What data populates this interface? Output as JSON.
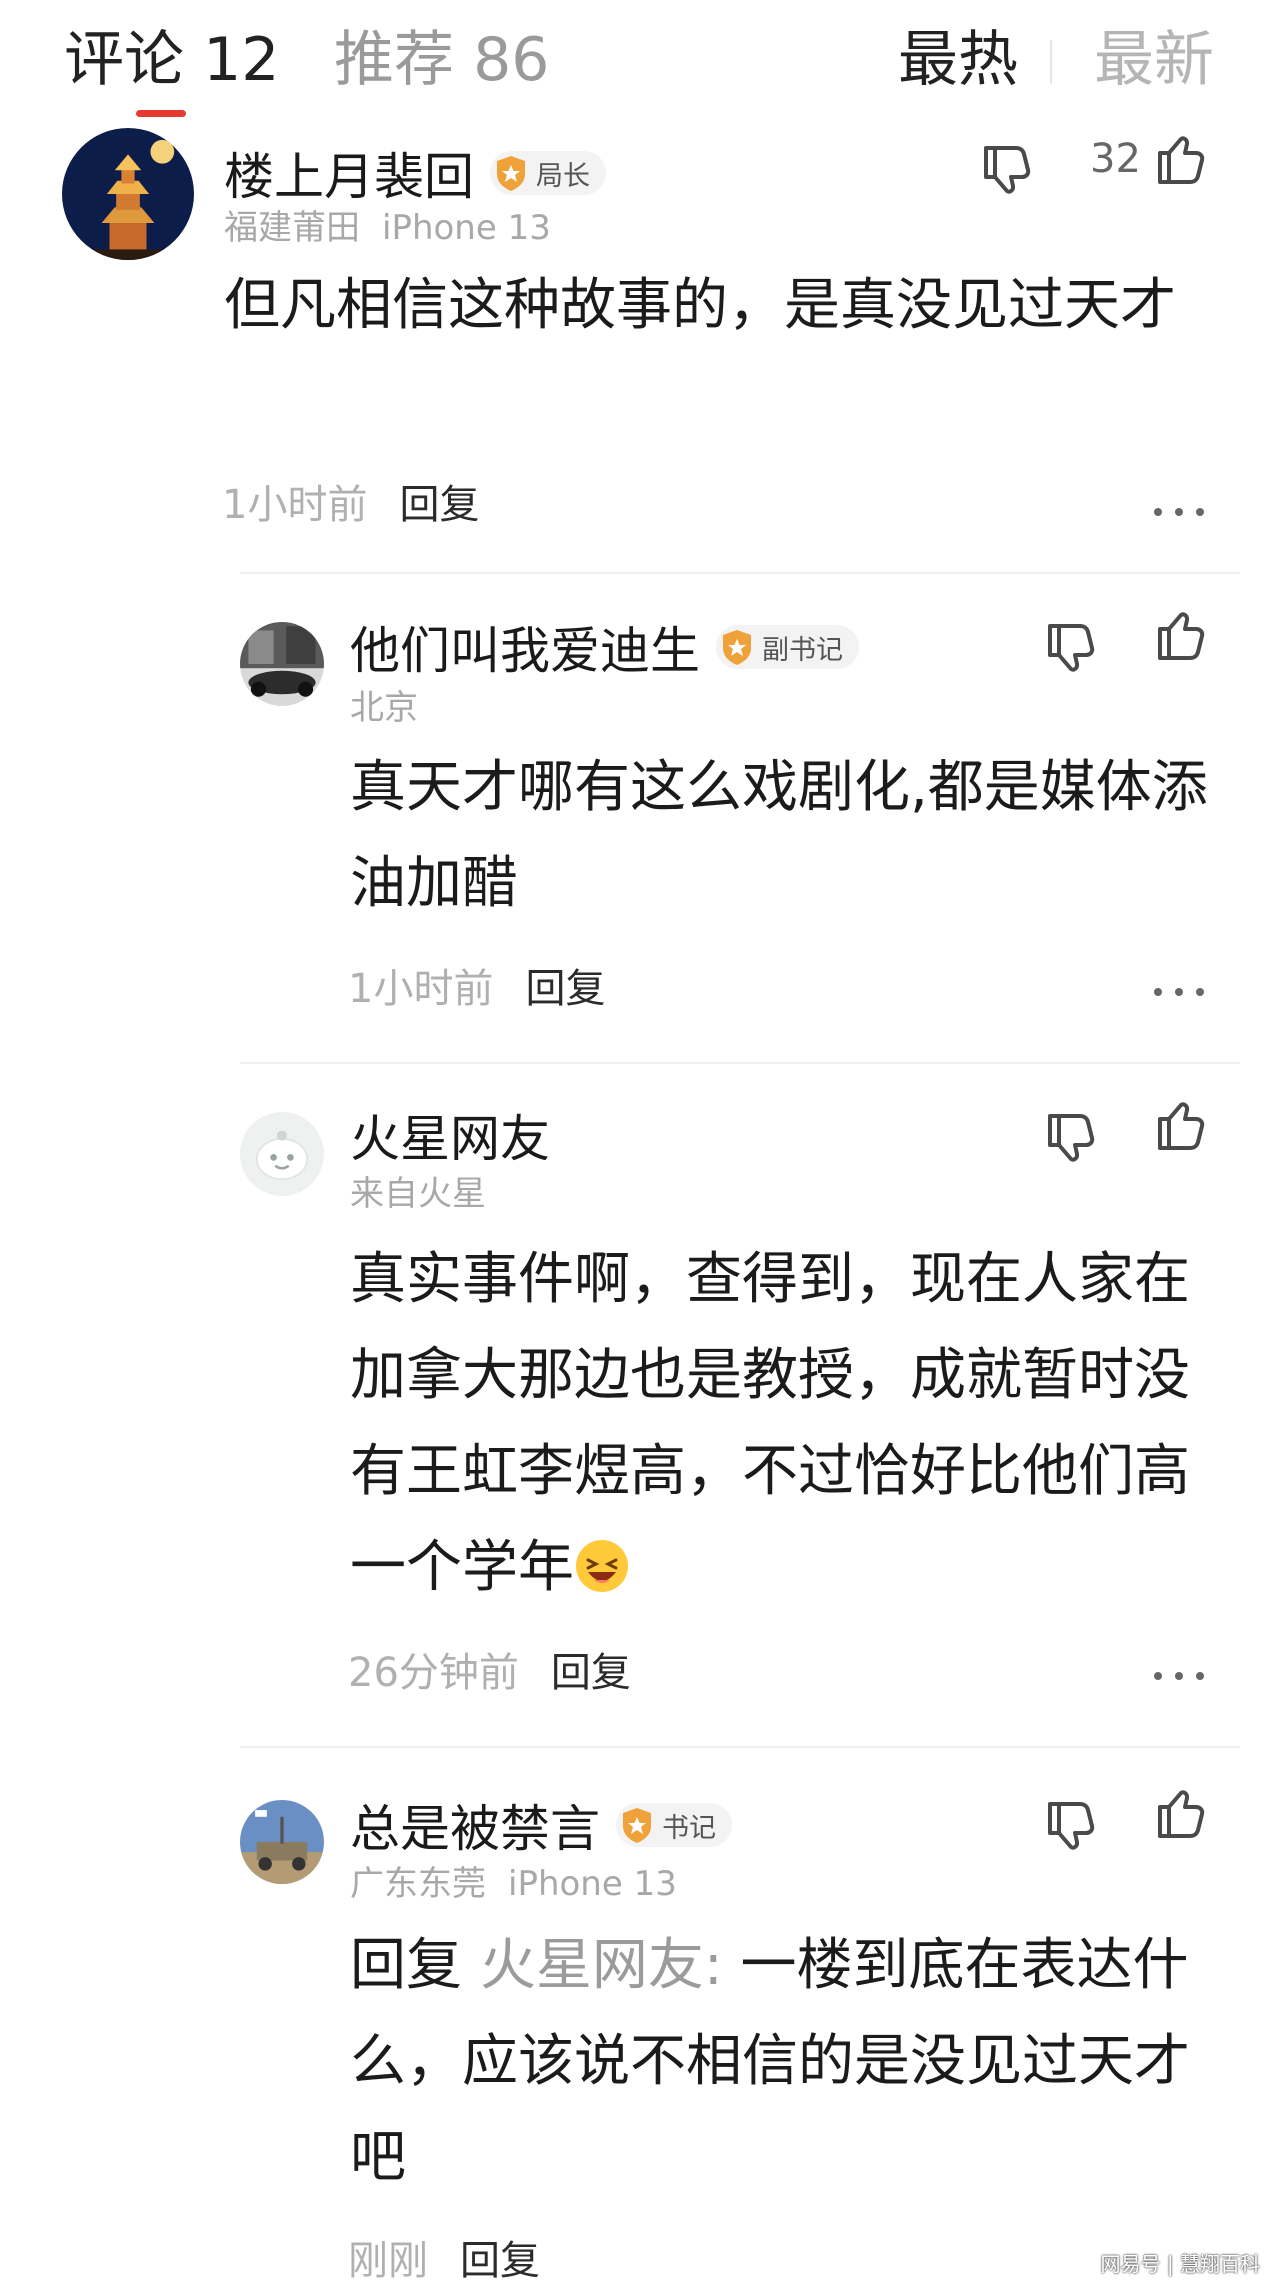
{
  "tabs": {
    "comments": "评论 12",
    "recommend": "推荐 86",
    "hot": "最热",
    "latest": "最新"
  },
  "comments": [
    {
      "name": "楼上月裴回",
      "badge": "局长",
      "location": "福建莆田",
      "device": "iPhone 13",
      "text": "但凡相信这种故事的，是真没见过天才",
      "time": "1小时前",
      "reply_label": "回复",
      "likes": "32"
    },
    {
      "name": "他们叫我爱迪生",
      "badge": "副书记",
      "location": "北京",
      "text": "真天才哪有这么戏剧化,都是媒体添油加醋",
      "time": "1小时前",
      "reply_label": "回复"
    },
    {
      "name": "火星网友",
      "location": "来自火星",
      "text": "真实事件啊，查得到，现在人家在加拿大那边也是教授，成就暂时没有王虹李煜高，不过恰好比他们高一个学年",
      "time": "26分钟前",
      "reply_label": "回复"
    },
    {
      "name": "总是被禁言",
      "badge": "书记",
      "location": "广东东莞",
      "device": "iPhone 13",
      "text_prefix": "回复 ",
      "reply_to": "火星网友:",
      "text": " 一楼到底在表达什么，应该说不相信的是没见过天才吧",
      "time": "刚刚",
      "reply_label": "回复"
    }
  ],
  "watermark": "网易号 | 慧翔百科",
  "colors": {
    "accent": "#e53a2f",
    "badge_orange": "#f0a23a",
    "muted": "#a8a8a8"
  },
  "icons": [
    "thumbs-down-icon",
    "thumbs-up-icon",
    "more-icon",
    "badge-shield-icon",
    "laughing-emoji-icon"
  ]
}
